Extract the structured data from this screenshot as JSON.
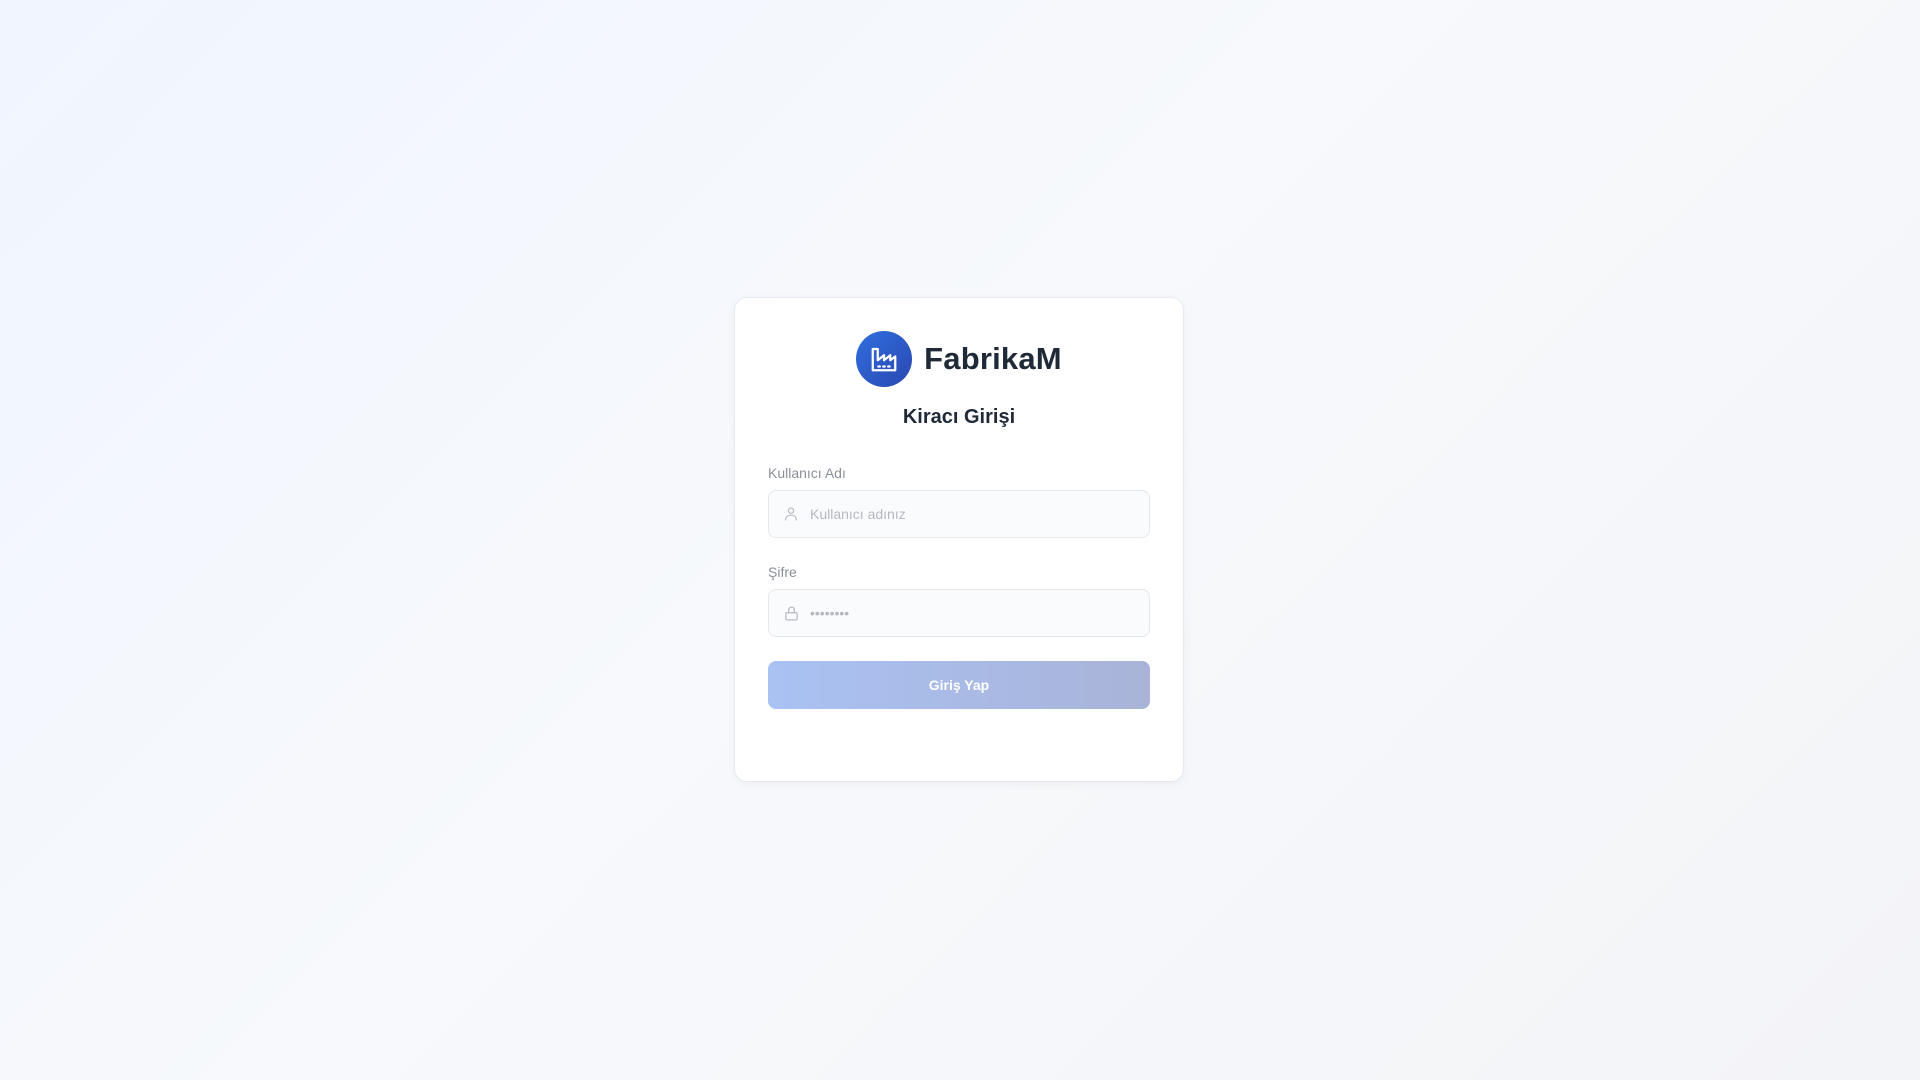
{
  "brand": {
    "name": "FabrikaM",
    "logo_icon": "factory-icon",
    "accent_color": "#2f5fd0"
  },
  "login": {
    "title": "Kiracı Girişi",
    "username": {
      "label": "Kullanıcı Adı",
      "placeholder": "Kullanıcı adınız",
      "value": "",
      "icon": "user-icon"
    },
    "password": {
      "label": "Şifre",
      "placeholder": "••••••••",
      "value": "",
      "icon": "lock-icon"
    },
    "submit_label": "Giriş Yap"
  }
}
